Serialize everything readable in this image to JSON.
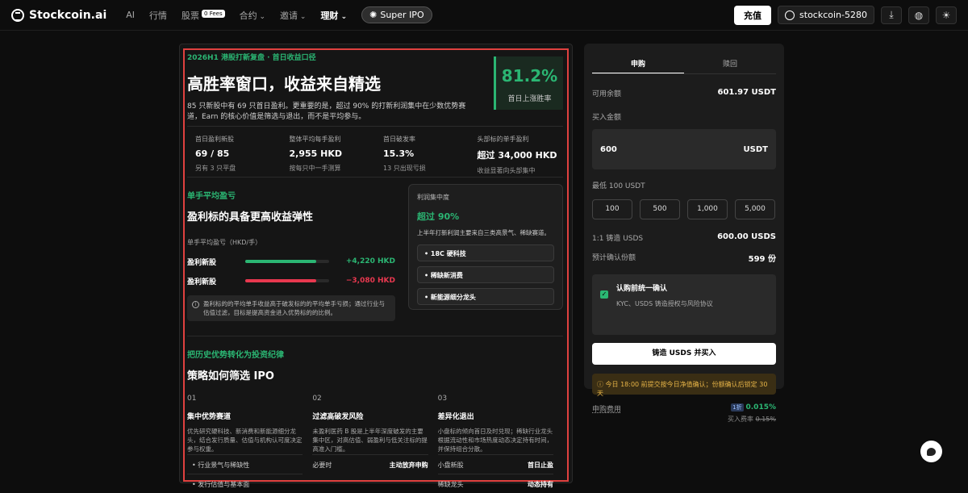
{
  "brand": {
    "name": "Stockcoin.ai"
  },
  "nav": {
    "items": [
      "AI",
      "行情",
      "股票",
      "合约",
      "邀请",
      "理财"
    ],
    "fees_badge": "0 Fees",
    "super_ipo": "Super IPO"
  },
  "header": {
    "deposit": "充值",
    "account": "stockcoin-5280"
  },
  "hero": {
    "eyebrow": "2026H1 港股打新复盘 · 首日收益口径",
    "title": "高胜率窗口，收益来自精选",
    "desc": "85 只新股中有 69 只首日盈利。更重要的是，超过 90% 的打新利润集中在少数优势赛道，Earn 的核心价值是筛选与退出，而不是平均参与。",
    "win_value": "81.2%",
    "win_label": "首日上涨胜率"
  },
  "stats": [
    {
      "label": "首日盈利新股",
      "value": "69 / 85",
      "sub": "另有 3 只平盘"
    },
    {
      "label": "整体平均每手盈利",
      "value": "2,955 HKD",
      "sub": "按每只中一手测算"
    },
    {
      "label": "首日破发率",
      "value": "15.3%",
      "sub": "13 只出现亏损"
    },
    {
      "label": "头部标的单手盈利",
      "value": "超过 34,000 HKD",
      "sub": "收益显著向头部集中"
    }
  ],
  "pnl": {
    "eyebrow": "单手平均盈亏",
    "title": "盈利标的具备更高收益弹性",
    "unit_label": "单手平均盈亏（HKD/手）",
    "rows": [
      {
        "name": "盈利新股",
        "value": "+4,220 HKD",
        "ratio": 0.85,
        "color": "#2bb673"
      },
      {
        "name": "盈利新股",
        "value": "−3,080 HKD",
        "ratio": 0.85,
        "color": "#e8384f"
      }
    ],
    "note": "盈利标的的平均单手收益高于破发标的的平均单手亏损；通过行业与估值过滤，目标是提高资金进入优势标的的比例。"
  },
  "concentration": {
    "label": "利润集中度",
    "value": "超过 90%",
    "desc": "上半年打新利润主要来自三类高景气、稀缺赛道。",
    "items": [
      "18C 硬科技",
      "稀缺新消费",
      "新能源细分龙头"
    ]
  },
  "strategy": {
    "eyebrow": "把历史优势转化为投资纪律",
    "title": "策略如何筛选 IPO",
    "cols": [
      {
        "num": "01",
        "title": "集中优势赛道",
        "desc": "优先研究硬科技、新消费和新能源细分龙头，结合发行质量、估值与机构认可度决定参与权重。",
        "bullets": [
          "行业景气与稀缺性",
          "发行估值与基本面"
        ]
      },
      {
        "num": "02",
        "title": "过滤高破发风险",
        "desc": "未盈利医药 B 股是上半年深度破发的主要集中区，对高估值、弱盈利与低关注标的提高准入门槛。",
        "kv": [
          {
            "k": "必要时",
            "v": "主动放弃申购"
          }
        ]
      },
      {
        "num": "03",
        "title": "差异化退出",
        "desc": "小盘标的倾向首日及时兑现；稀缺行业龙头根据流动性和市场热度动态决定持有时间，并保持组合分散。",
        "kv": [
          {
            "k": "小盘新股",
            "v": "首日止盈"
          },
          {
            "k": "稀缺龙头",
            "v": "动态持有"
          }
        ]
      }
    ]
  },
  "panel": {
    "tabs": [
      "申购",
      "赎回"
    ],
    "available_label": "可用余额",
    "available_value": "601.97 USDT",
    "amount_label": "买入金额",
    "amount_value": "600",
    "amount_unit": "USDT",
    "min_label": "最低 100 USDT",
    "quick": [
      "100",
      "500",
      "1,000",
      "5,000"
    ],
    "mint_label": "1:1 铸造 USDS",
    "mint_value": "600.00 USDS",
    "shares_label": "预计确认份额",
    "shares_value": "599 份",
    "confirm_title": "认购前统一确认",
    "confirm_sub": "KYC、USDS 铸造授权与风险协议",
    "mint_button": "铸造 USDS 并买入",
    "warning": "今日 18:00 前提交按今日净值确认；份额确认后锁定 30 天",
    "fee_label": "申购费用",
    "fee_tag": "1折",
    "fee_value": "0.015%",
    "fee_old_label": "买入费率",
    "fee_old_value": "0.15%"
  },
  "colors": {
    "accent_green": "#2bb673",
    "loss_red": "#e8384f",
    "highlight": "#e0413f",
    "warning": "#e7b447"
  }
}
